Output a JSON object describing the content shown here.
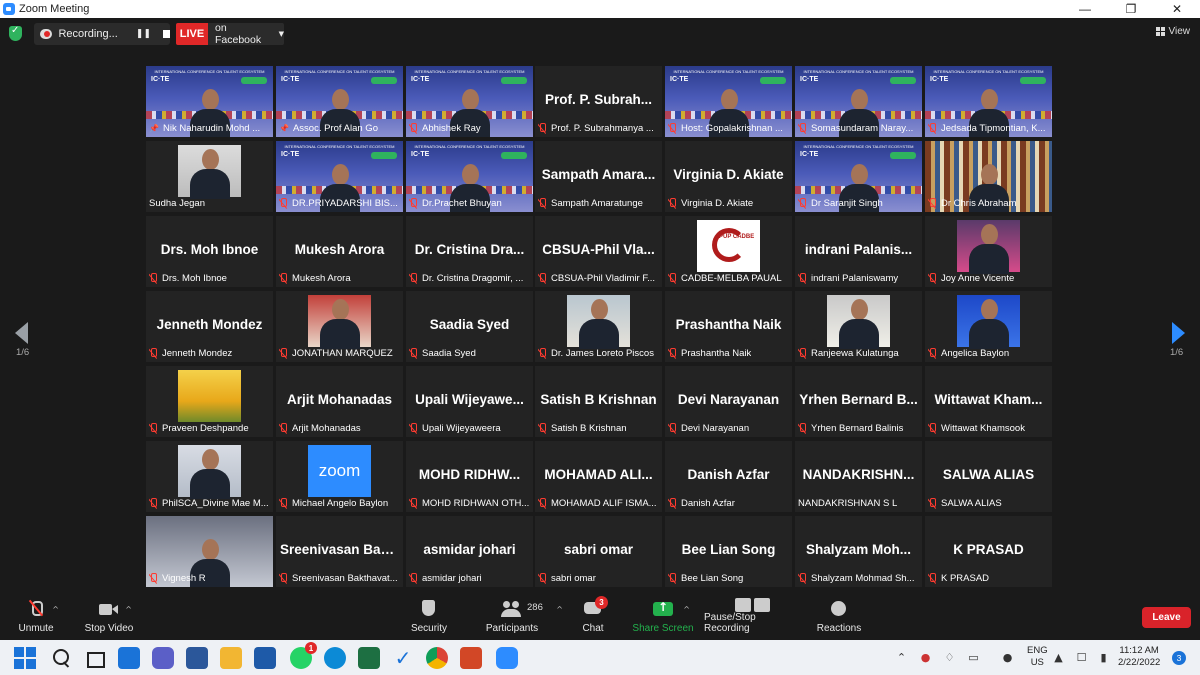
{
  "window": {
    "title": "Zoom Meeting"
  },
  "topbar": {
    "recording_label": "Recording...",
    "live_label": "LIVE",
    "live_destination": "on Facebook",
    "view_label": "View"
  },
  "gallery": {
    "page_left": "1/6",
    "page_right": "1/6",
    "tiles": [
      {
        "caption": "Nik Naharudin Mohd ...",
        "big": "",
        "video": "conf",
        "pinned": true,
        "muted": false,
        "active": true
      },
      {
        "caption": "Assoc. Prof Alan Go",
        "big": "",
        "video": "conf",
        "pinned": true,
        "muted": false,
        "active": false
      },
      {
        "caption": "Abhishek Ray",
        "big": "",
        "video": "conf",
        "pinned": false,
        "muted": true,
        "active": false
      },
      {
        "caption": "Prof. P. Subrahmanya ...",
        "big": "Prof. P. Subrah...",
        "video": "",
        "pinned": false,
        "muted": true,
        "active": false
      },
      {
        "caption": "Host: Gopalakrishnan ...",
        "big": "",
        "video": "conf",
        "pinned": false,
        "muted": true,
        "active": false
      },
      {
        "caption": "Somasundaram Naray...",
        "big": "",
        "video": "conf",
        "pinned": false,
        "muted": true,
        "active": false
      },
      {
        "caption": "Jedsada Tipmontian, K...",
        "big": "",
        "video": "conf",
        "pinned": false,
        "muted": true,
        "active": false
      },
      {
        "caption": "Sudha Jegan",
        "big": "",
        "video": "room",
        "pinned": false,
        "muted": false,
        "active": false
      },
      {
        "caption": "DR.PRIYADARSHI BIS...",
        "big": "",
        "video": "conf",
        "pinned": false,
        "muted": true,
        "active": false
      },
      {
        "caption": "Dr.Prachet Bhuyan",
        "big": "",
        "video": "conf",
        "pinned": false,
        "muted": true,
        "active": false
      },
      {
        "caption": "Sampath Amaratunge",
        "big": "Sampath  Amara...",
        "video": "",
        "pinned": false,
        "muted": true,
        "active": false
      },
      {
        "caption": "Virginia D. Akiate",
        "big": "Virginia D. Akiate",
        "video": "",
        "pinned": false,
        "muted": true,
        "active": false
      },
      {
        "caption": "Dr Saranjit Singh",
        "big": "",
        "video": "conf",
        "pinned": false,
        "muted": true,
        "active": false
      },
      {
        "caption": "Dr Chris Abraham",
        "big": "",
        "video": "books",
        "pinned": false,
        "muted": true,
        "active": false
      },
      {
        "caption": "Drs. Moh Ibnoe",
        "big": "Drs. Moh Ibnoe",
        "video": "",
        "pinned": false,
        "muted": true,
        "active": false
      },
      {
        "caption": "Mukesh Arora",
        "big": "Mukesh Arora",
        "video": "",
        "pinned": false,
        "muted": true,
        "active": false
      },
      {
        "caption": "Dr. Cristina Dragomir, ...",
        "big": "Dr. Cristina  Dra...",
        "video": "",
        "pinned": false,
        "muted": true,
        "active": false
      },
      {
        "caption": "CBSUA-Phil Vladimir F...",
        "big": "CBSUA-Phil  Vla...",
        "video": "",
        "pinned": false,
        "muted": true,
        "active": false
      },
      {
        "caption": "CADBE-MELBA PAUAL",
        "big": "",
        "video": "cadbe",
        "pinned": false,
        "muted": true,
        "active": false
      },
      {
        "caption": "indrani Palaniswamy",
        "big": "indrani  Palanis...",
        "video": "",
        "pinned": false,
        "muted": true,
        "active": false
      },
      {
        "caption": "Joy Anne Vicente",
        "big": "",
        "video": "pink",
        "pinned": false,
        "muted": true,
        "active": false
      },
      {
        "caption": "Jenneth Mondez",
        "big": "Jenneth Mondez",
        "video": "",
        "pinned": false,
        "muted": true,
        "active": false
      },
      {
        "caption": "JONATHAN MARQUEZ",
        "big": "",
        "video": "redwall",
        "pinned": false,
        "muted": true,
        "active": false
      },
      {
        "caption": "Saadia Syed",
        "big": "Saadia Syed",
        "video": "",
        "pinned": false,
        "muted": true,
        "active": false
      },
      {
        "caption": "Dr. James Loreto Piscos",
        "big": "",
        "video": "outdoor",
        "pinned": false,
        "muted": true,
        "active": false
      },
      {
        "caption": "Prashantha Naik",
        "big": "Prashantha Naik",
        "video": "",
        "pinned": false,
        "muted": true,
        "active": false
      },
      {
        "caption": "Ranjeewa Kulatunga",
        "big": "",
        "video": "field",
        "pinned": false,
        "muted": true,
        "active": false
      },
      {
        "caption": "Angelica Baylon",
        "big": "",
        "video": "blue",
        "pinned": false,
        "muted": true,
        "active": false
      },
      {
        "caption": "Praveen Deshpande",
        "big": "",
        "video": "tulips",
        "pinned": false,
        "muted": true,
        "active": false
      },
      {
        "caption": "Arjit Mohanadas",
        "big": "Arjit Mohanadas",
        "video": "",
        "pinned": false,
        "muted": true,
        "active": false
      },
      {
        "caption": "Upali Wijeyaweera",
        "big": "Upali  Wijeyawe...",
        "video": "",
        "pinned": false,
        "muted": true,
        "active": false
      },
      {
        "caption": "Satish B Krishnan",
        "big": "Satish B Krishnan",
        "video": "",
        "pinned": false,
        "muted": true,
        "active": false
      },
      {
        "caption": "Devi Narayanan",
        "big": "Devi Narayanan",
        "video": "",
        "pinned": false,
        "muted": true,
        "active": false
      },
      {
        "caption": "Yrhen Bernard Balinis",
        "big": "Yrhen  Bernard  B...",
        "video": "",
        "pinned": false,
        "muted": true,
        "active": false
      },
      {
        "caption": "Wittawat Khamsook",
        "big": "Wittawat  Kham...",
        "video": "",
        "pinned": false,
        "muted": true,
        "active": false
      },
      {
        "caption": "PhilSCA_Divine Mae M...",
        "big": "",
        "video": "bluegrad",
        "pinned": false,
        "muted": true,
        "active": false
      },
      {
        "caption": "Michael Angelo Baylon",
        "big": "",
        "video": "zoomlogo",
        "pinned": false,
        "muted": true,
        "active": false
      },
      {
        "caption": "MOHD RIDHWAN OTH...",
        "big": "MOHD  RIDHW...",
        "video": "",
        "pinned": false,
        "muted": true,
        "active": false
      },
      {
        "caption": "MOHAMAD ALIF ISMA...",
        "big": "MOHAMAD  ALI...",
        "video": "",
        "pinned": false,
        "muted": true,
        "active": false
      },
      {
        "caption": "Danish Azfar",
        "big": "Danish Azfar",
        "video": "",
        "pinned": false,
        "muted": true,
        "active": false
      },
      {
        "caption": "NANDAKRISHNAN S L",
        "big": "NANDAKRISHN...",
        "video": "",
        "pinned": false,
        "muted": false,
        "active": false
      },
      {
        "caption": "SALWA ALIAS",
        "big": "SALWA ALIAS",
        "video": "",
        "pinned": false,
        "muted": true,
        "active": false
      },
      {
        "caption": "Vignesh R",
        "big": "",
        "video": "office",
        "pinned": false,
        "muted": true,
        "active": false
      },
      {
        "caption": "Sreenivasan Bakthavat...",
        "big": "Sreenivasan  Bak...",
        "video": "",
        "pinned": false,
        "muted": true,
        "active": false
      },
      {
        "caption": "asmidar johari",
        "big": "asmidar johari",
        "video": "",
        "pinned": false,
        "muted": true,
        "active": false
      },
      {
        "caption": "sabri omar",
        "big": "sabri omar",
        "video": "",
        "pinned": false,
        "muted": true,
        "active": false
      },
      {
        "caption": "Bee Lian Song",
        "big": "Bee Lian Song",
        "video": "",
        "pinned": false,
        "muted": true,
        "active": false
      },
      {
        "caption": "Shalyzam Mohmad Sh...",
        "big": "Shalyzam  Moh...",
        "video": "",
        "pinned": false,
        "muted": true,
        "active": false
      },
      {
        "caption": "K PRASAD",
        "big": "K PRASAD",
        "video": "",
        "pinned": false,
        "muted": true,
        "active": false
      }
    ],
    "conf_banner": "INTERNATIONAL CONFERENCE ON TALENT ECOSYSTEM",
    "conf_logo": "IC·TE",
    "cadbe_text": "PUP CADBE",
    "zoom_logo_text": "zoom"
  },
  "toolbar": {
    "unmute": "Unmute",
    "stop_video": "Stop Video",
    "security": "Security",
    "participants": "Participants",
    "participants_count": "286",
    "chat": "Chat",
    "chat_badge": "3",
    "share_screen": "Share Screen",
    "pause_stop_recording": "Pause/Stop Recording",
    "reactions": "Reactions",
    "leave": "Leave",
    "share_color": "#23b14d",
    "leave_color": "#d9232a"
  },
  "taskbar": {
    "whatsapp_badge": "1",
    "lang_line1": "ENG",
    "lang_line2": "US",
    "time": "11:12 AM",
    "date": "2/22/2022",
    "notification_count": "3"
  }
}
